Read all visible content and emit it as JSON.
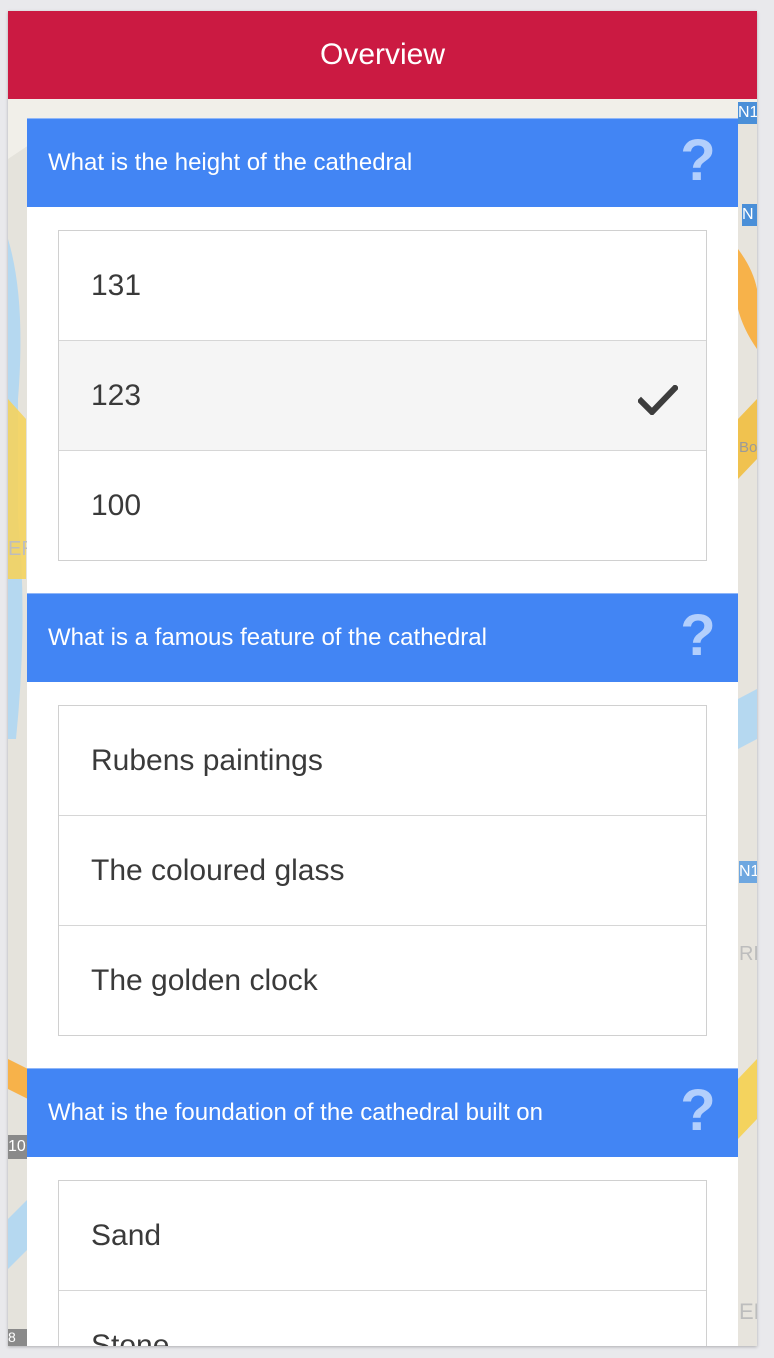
{
  "header": {
    "title": "Overview"
  },
  "questions": [
    {
      "text": "What is the height of the cathedral",
      "help_icon": "question-mark-icon",
      "answers": [
        {
          "label": "131",
          "selected": false
        },
        {
          "label": "123",
          "selected": true
        },
        {
          "label": "100",
          "selected": false
        }
      ]
    },
    {
      "text": "What is a famous feature of the cathedral",
      "help_icon": "question-mark-icon",
      "answers": [
        {
          "label": "Rubens paintings",
          "selected": false
        },
        {
          "label": "The coloured glass",
          "selected": false
        },
        {
          "label": "The golden clock",
          "selected": false
        }
      ]
    },
    {
      "text": "What is the foundation of the cathedral built on",
      "help_icon": "question-mark-icon",
      "answers": [
        {
          "label": "Sand",
          "selected": false
        },
        {
          "label": "Stone",
          "selected": false
        }
      ]
    }
  ],
  "map_labels": {
    "right_top_1": "N1",
    "right_top_2": "N",
    "right_mid_1": "Bo",
    "right_mid_2": "N1",
    "right_mid_3": "RE",
    "right_bottom": "ER",
    "left_1": "ER",
    "left_2": "10",
    "left_3": "8"
  },
  "colors": {
    "header_bg": "#cb1a42",
    "question_bg": "#4285f4",
    "selected_bg": "#f5f5f5"
  }
}
